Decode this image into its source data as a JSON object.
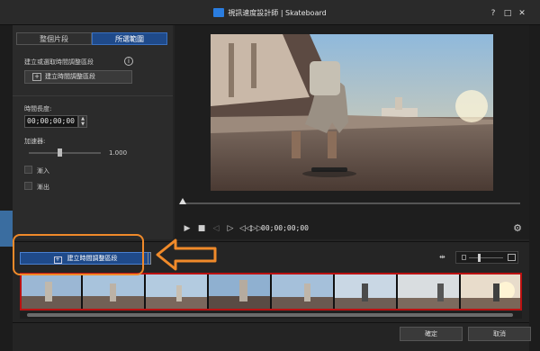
{
  "window": {
    "title": "視訊速度設計師 | Skateboard",
    "help_label": "?",
    "restore_label": "□",
    "close_label": "✕"
  },
  "left_panel": {
    "tabs": [
      {
        "label": "整個片段",
        "selected": false
      },
      {
        "label": "所選範圍",
        "selected": true
      }
    ],
    "section_label": "建立或選取時間調整區段",
    "info_icon": "i",
    "create_button_label": "建立時間調整區段",
    "duration_label": "時間長度:",
    "duration_value": "00;00;00;00",
    "speed_label": "加速器:",
    "speed_value": "1.000",
    "fade_in_label": "漸入",
    "fade_out_label": "漸出"
  },
  "player": {
    "timecode": "00;00;00;00",
    "icons": [
      "play-icon",
      "stop-icon",
      "previous-frame-icon",
      "next-frame-icon",
      "rewind-icon",
      "fast-forward-icon",
      "settings-icon"
    ]
  },
  "timeline": {
    "create_button_label": "建立時間調整區段",
    "zoom_level": 0.25
  },
  "dialog_buttons": {
    "ok_label": "確定",
    "cancel_label": "取消"
  },
  "colors": {
    "accent": "#1f4a8a",
    "highlight_annotation": "#f08a2a"
  }
}
